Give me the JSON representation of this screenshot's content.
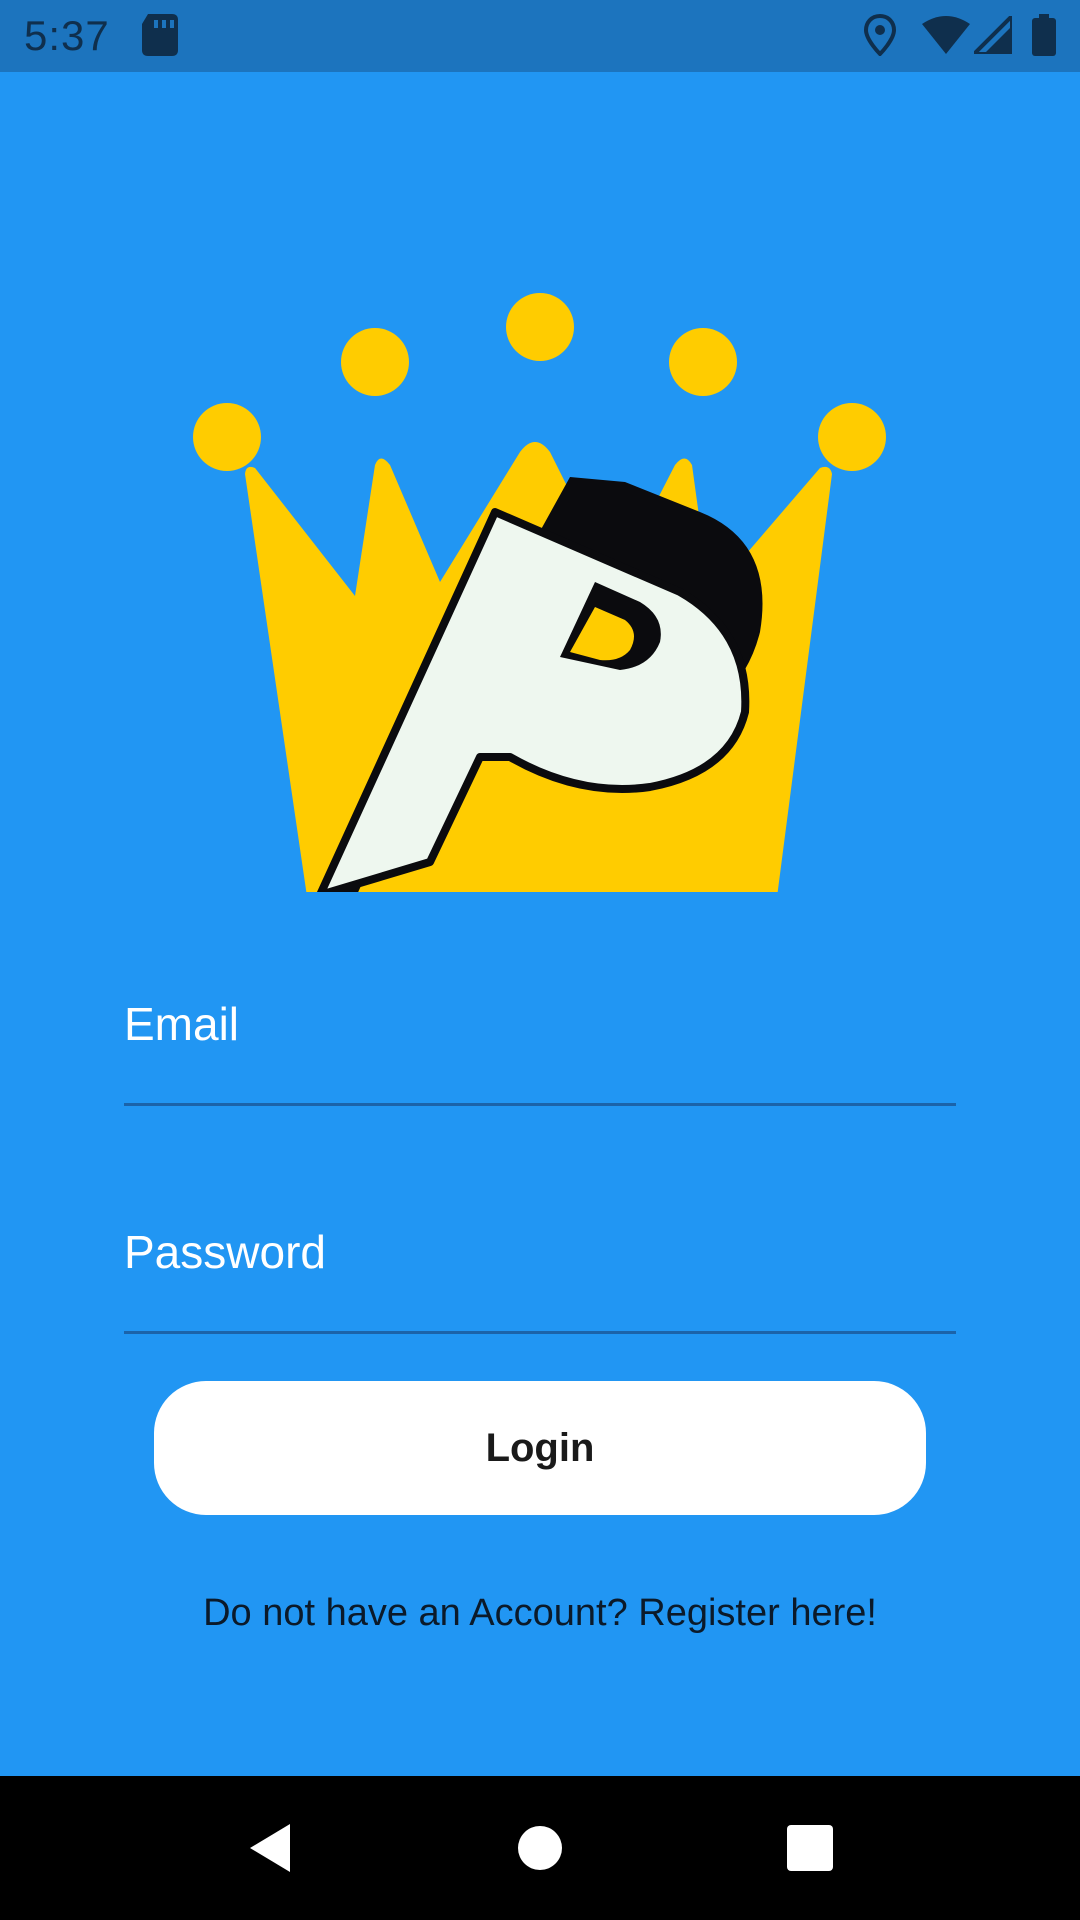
{
  "status_bar": {
    "time": "5:37",
    "icons": [
      "sd-card-icon",
      "location-icon",
      "wifi-icon",
      "signal-icon",
      "battery-icon"
    ]
  },
  "logo": {
    "name": "crown-p-logo",
    "colors": {
      "crown": "#FFCC00",
      "letter": "#EEF7EF",
      "shadow": "#0B0B0E"
    }
  },
  "form": {
    "email": {
      "label": "Email",
      "value": "",
      "placeholder": ""
    },
    "password": {
      "label": "Password",
      "value": "",
      "placeholder": ""
    },
    "login_label": "Login",
    "register_text": "Do not have an Account? Register here!"
  },
  "nav_bar": {
    "icons": [
      "back-icon",
      "home-icon",
      "recents-icon"
    ]
  },
  "colors": {
    "background": "#2196F3",
    "status_bar": "#1C74BE",
    "button_bg": "#FFFFFF",
    "accent_yellow": "#FFCC00"
  }
}
